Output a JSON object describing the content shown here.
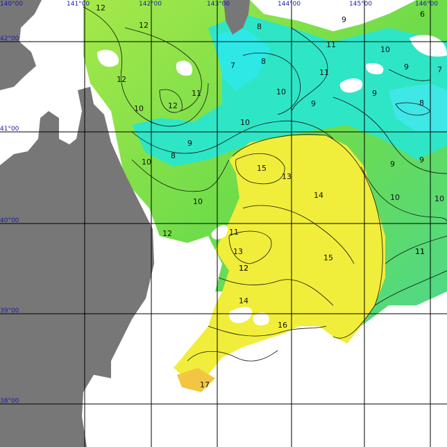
{
  "map": {
    "longitude_labels": [
      "140°00",
      "141°00",
      "142°00",
      "143°00",
      "144°00",
      "145°00",
      "146°00"
    ],
    "latitude_labels": [
      "42°00",
      "41°00",
      "40°00",
      "39°00",
      "38°00"
    ],
    "temperature_labels": [
      "12",
      "12",
      "12",
      "11",
      "10",
      "12",
      "8",
      "7",
      "8",
      "9",
      "10",
      "11",
      "9",
      "10",
      "9",
      "6",
      "7",
      "10",
      "9",
      "8",
      "9",
      "10",
      "11",
      "8",
      "9",
      "12",
      "11",
      "10",
      "15",
      "13",
      "14",
      "9",
      "10",
      "10",
      "12",
      "11",
      "13",
      "12",
      "15",
      "11",
      "14",
      "16",
      "17"
    ],
    "colors": {
      "land": "#777777",
      "no_data": "#ffffff",
      "warm_yellow": "#f0ee3a",
      "mid_green": "#7fdd45",
      "teal": "#2ee6c6",
      "cool_cyan": "#2ee8e8",
      "grid": "#000000",
      "coord_label": "#1a1aa6"
    }
  }
}
